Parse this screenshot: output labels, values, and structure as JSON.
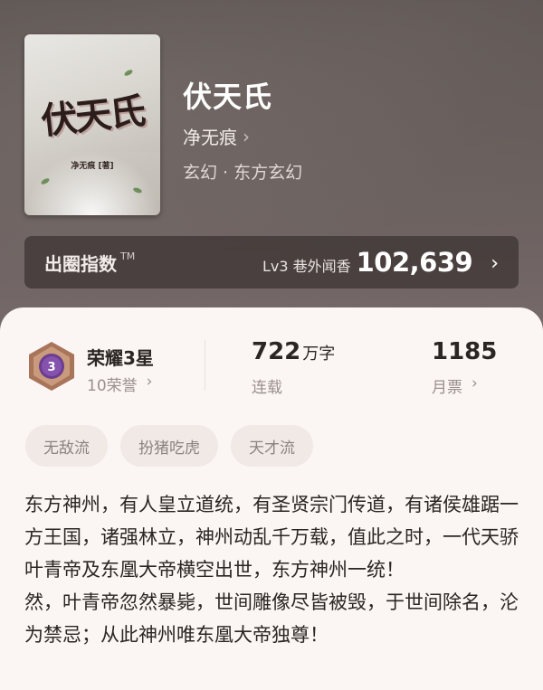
{
  "book": {
    "cover_title": "伏天氏",
    "cover_author": "净无痕 [著]",
    "title": "伏天氏",
    "author": "净无痕",
    "genre": "玄幻 · 东方玄幻"
  },
  "popularity": {
    "label": "出圈指数",
    "tm": "TM",
    "level": "Lv3 巷外闻香",
    "value": "102,639"
  },
  "stats": {
    "honor_title": "荣耀3星",
    "honor_sub": "10荣誉",
    "badge_level": "3",
    "words_value": "722",
    "words_unit": "万字",
    "words_label": "连载",
    "tickets_value": "1185",
    "tickets_label": "月票"
  },
  "tags": [
    "无敌流",
    "扮猪吃虎",
    "天才流"
  ],
  "synopsis": [
    "东方神州，有人皇立道统，有圣贤宗门传道，有诸侯雄踞一方王国，诸强林立，神州动乱千万载，值此之时，一代天骄叶青帝及东凰大帝横空出世，东方神州一统！",
    "然，叶青帝忽然暴毙，世间雕像尽皆被毁，于世间除名，沦为禁忌；从此神州唯东凰大帝独尊！"
  ],
  "colors": {
    "card_bg": "#fbf5f3",
    "tag_bg": "#f1e9e6",
    "badge_purple": "#6a3d8f",
    "badge_bronze": "#a8745a"
  },
  "icons": {
    "chevron": "chevron-right-icon",
    "badge": "honor-badge-icon"
  }
}
